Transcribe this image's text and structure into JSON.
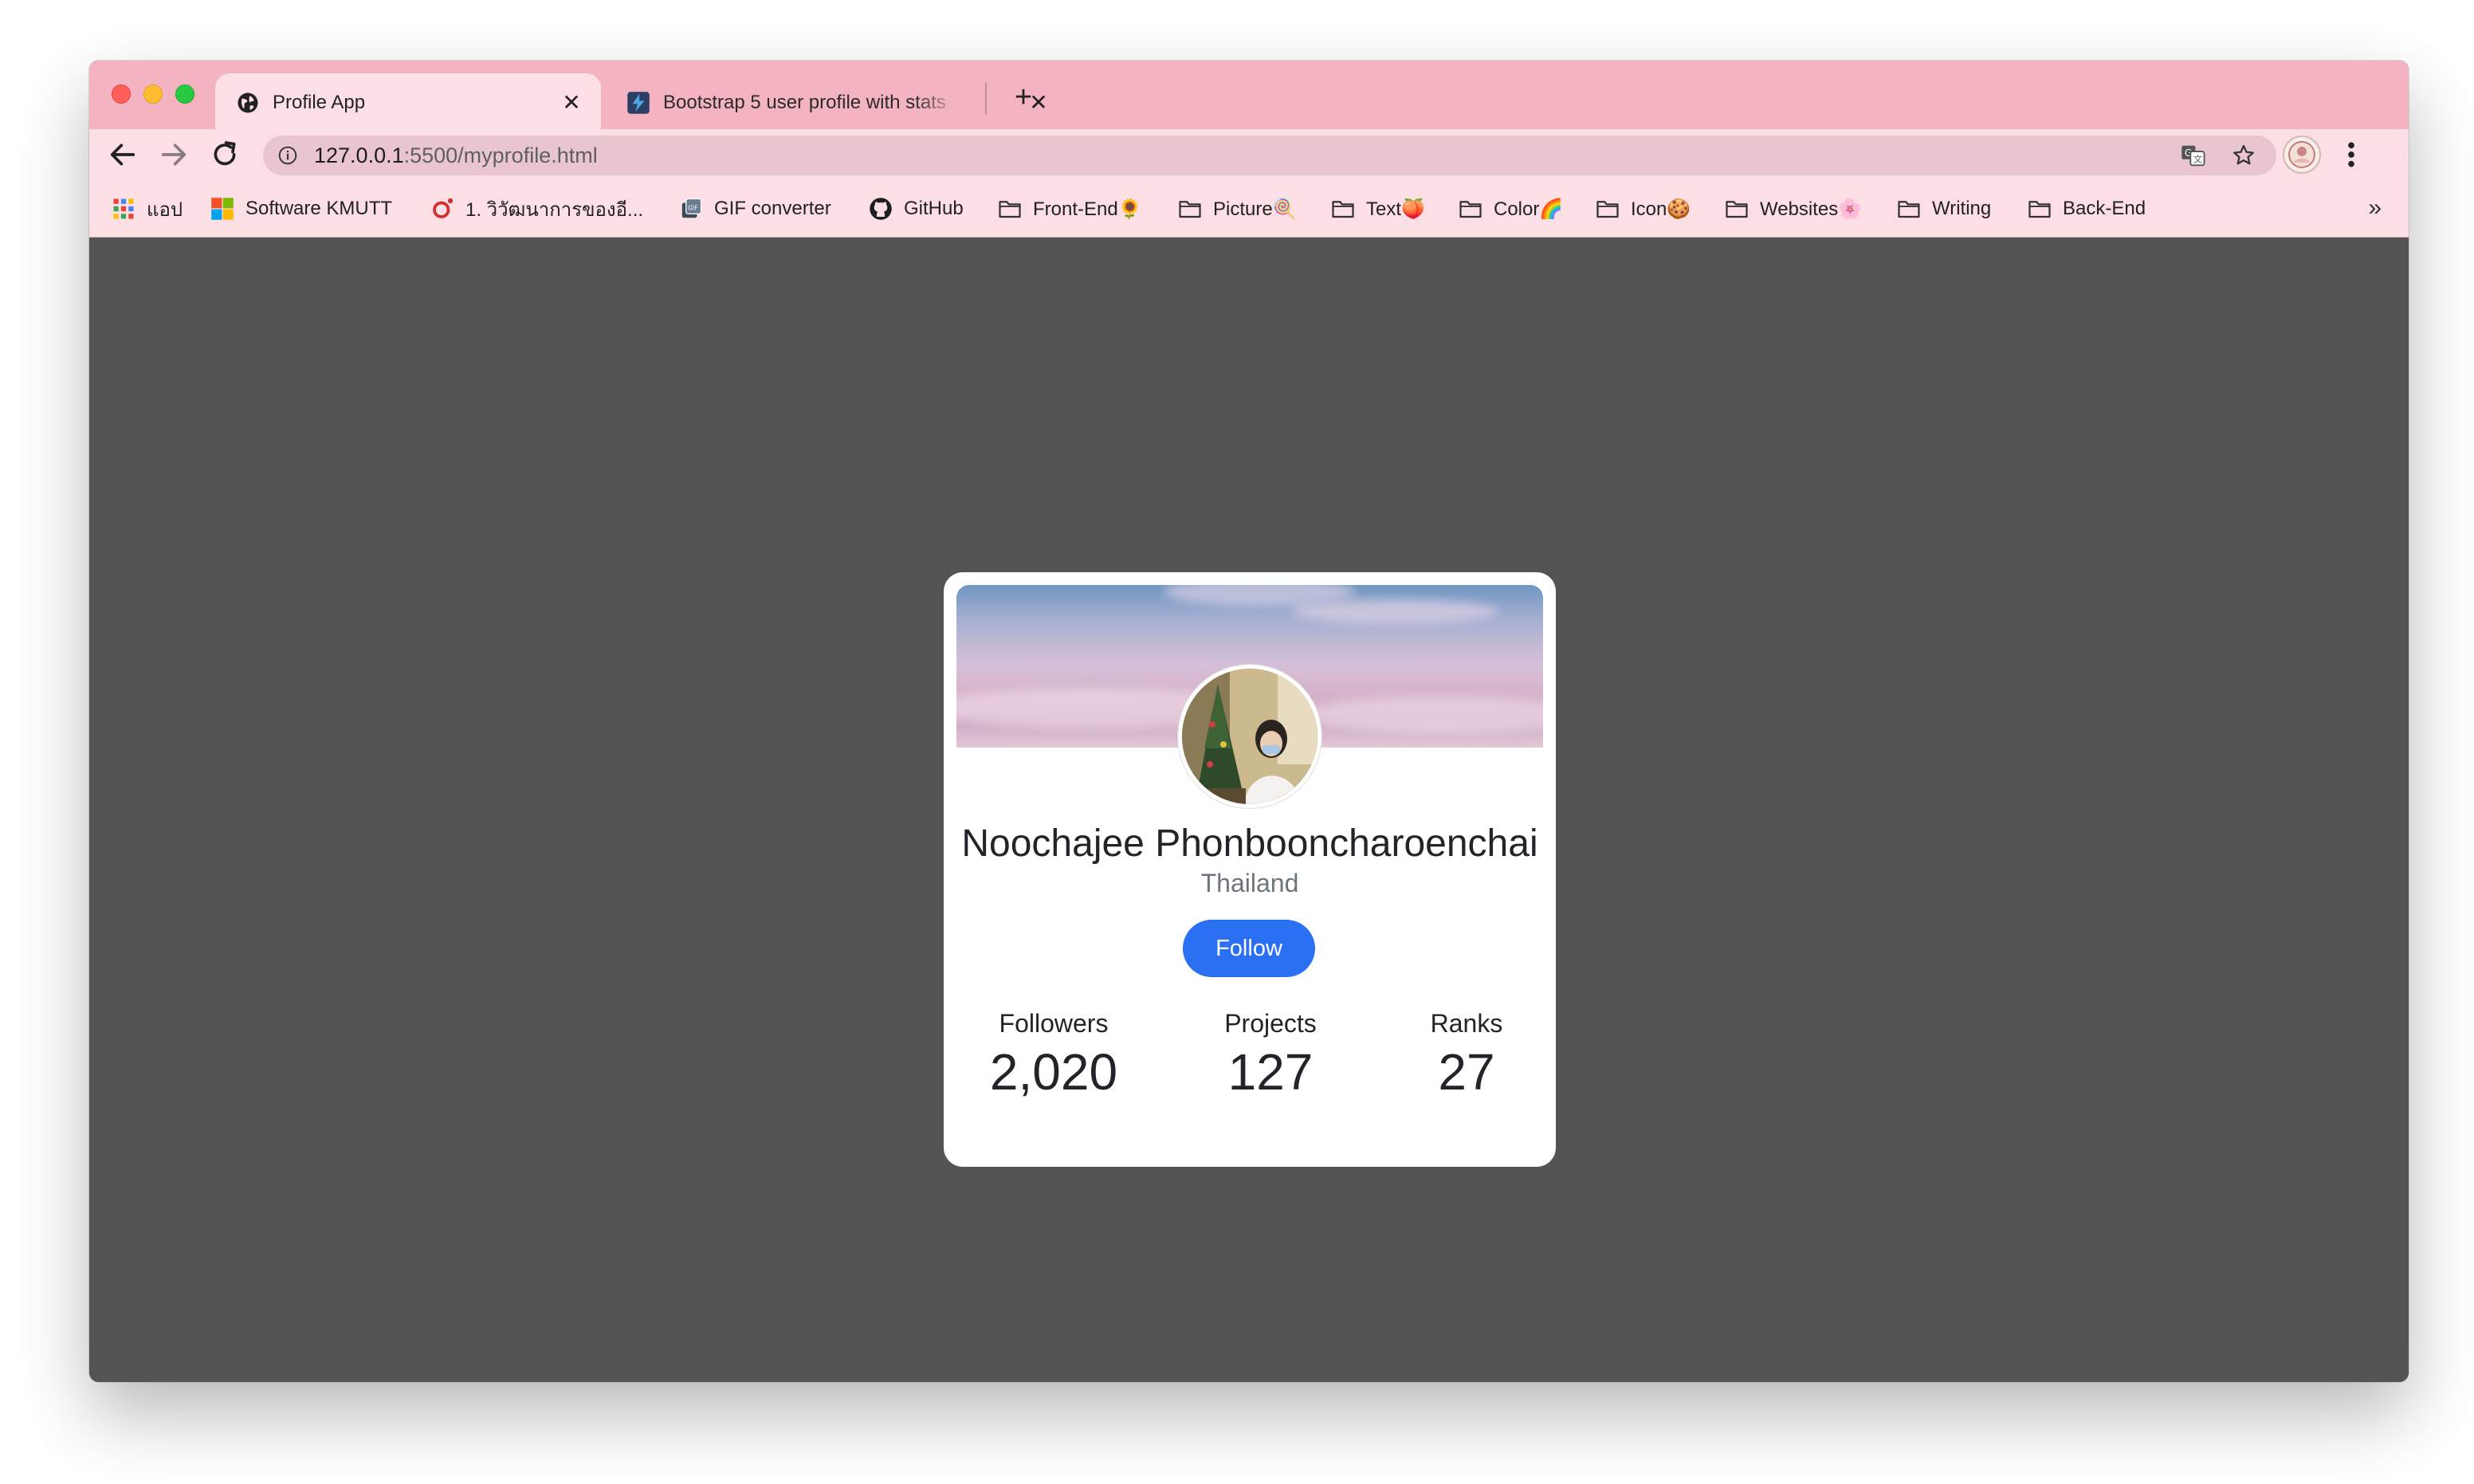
{
  "browser": {
    "tabs": [
      {
        "title": "Profile App",
        "active": true
      },
      {
        "title": "Bootstrap 5 user profile with stats",
        "active": false
      }
    ],
    "url_host": "127.0.0.1",
    "url_path": ":5500/myprofile.html",
    "bookmarks": [
      {
        "label": "แอป",
        "icon": "apps-grid-icon"
      },
      {
        "label": "Software KMUTT",
        "icon": "microsoft-logo-icon"
      },
      {
        "label": "1. วิวัฒนาการของอี...",
        "icon": "site-favicon-icon"
      },
      {
        "label": "GIF converter",
        "icon": "gif-converter-icon"
      },
      {
        "label": "GitHub",
        "icon": "github-icon"
      },
      {
        "label": "Front-End🌻",
        "icon": "folder-icon"
      },
      {
        "label": "Picture🍭",
        "icon": "folder-icon"
      },
      {
        "label": "Text🍑",
        "icon": "folder-icon"
      },
      {
        "label": "Color🌈",
        "icon": "folder-icon"
      },
      {
        "label": "Icon🍪",
        "icon": "folder-icon"
      },
      {
        "label": "Websites🌸",
        "icon": "folder-icon"
      },
      {
        "label": "Writing",
        "icon": "folder-icon"
      },
      {
        "label": "Back-End",
        "icon": "folder-icon"
      }
    ],
    "overflow_label": "»",
    "colors": {
      "tabstrip": "#f3b3c0",
      "toolbar": "#fbdfe4",
      "page_background": "#545454",
      "follow_button": "#2b6ff2"
    }
  },
  "profile": {
    "name": "Noochajee Phonbooncharoenchai",
    "country": "Thailand",
    "follow_label": "Follow",
    "stats": [
      {
        "label": "Followers",
        "value": "2,020"
      },
      {
        "label": "Projects",
        "value": "127"
      },
      {
        "label": "Ranks",
        "value": "27"
      }
    ]
  }
}
